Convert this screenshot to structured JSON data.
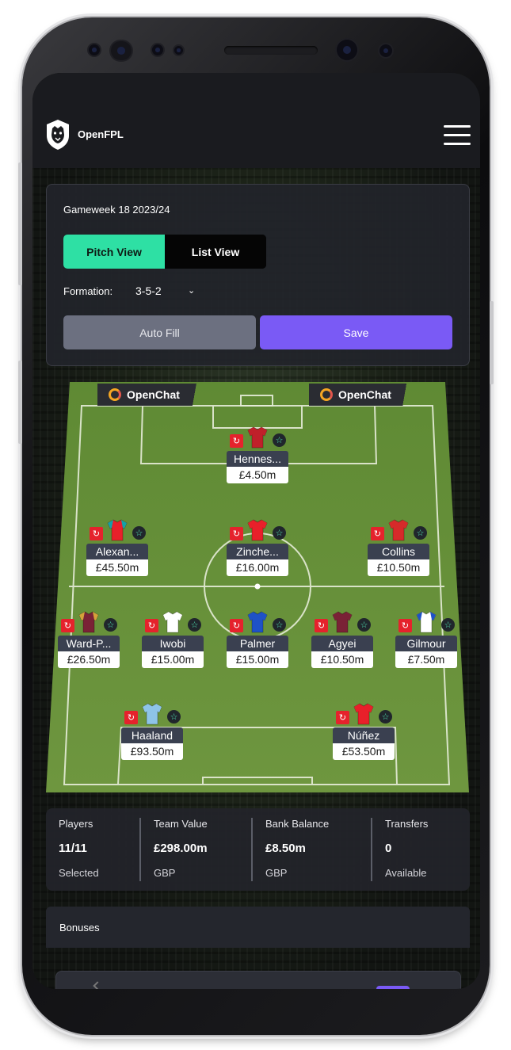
{
  "app": {
    "name": "OpenFPL"
  },
  "header": {
    "menu_icon": "hamburger-menu-icon",
    "logo_icon": "panther-shield-logo"
  },
  "team_panel": {
    "gameweek_label": "Gameweek 18 2023/24",
    "view_toggle": {
      "pitch_view": "Pitch View",
      "list_view": "List View",
      "selected": "Pitch View"
    },
    "formation_label": "Formation:",
    "formation_value": "3-5-2",
    "auto_fill_label": "Auto Fill",
    "save_label": "Save"
  },
  "sponsors": {
    "left": "OpenChat",
    "right": "OpenChat"
  },
  "players": [
    {
      "name": "Hennes...",
      "price": "£4.50m",
      "kit": "#c0202a",
      "sleeve": "#c0202a",
      "position": "GK"
    },
    {
      "name": "Alexan...",
      "price": "£45.50m",
      "kit": "#e8202a",
      "sleeve": "#12a2a8",
      "position": "DEF"
    },
    {
      "name": "Zinche...",
      "price": "£16.00m",
      "kit": "#e8202a",
      "sleeve": "#e8202a",
      "position": "DEF"
    },
    {
      "name": "Collins",
      "price": "£10.50m",
      "kit": "#d62a2a",
      "sleeve": "#d62a2a",
      "position": "DEF"
    },
    {
      "name": "Ward-P...",
      "price": "£26.50m",
      "kit": "#7a2236",
      "sleeve": "#d4a23a",
      "position": "MID"
    },
    {
      "name": "Iwobi",
      "price": "£15.00m",
      "kit": "#ffffff",
      "sleeve": "#ffffff",
      "position": "MID"
    },
    {
      "name": "Palmer",
      "price": "£15.00m",
      "kit": "#1f52c6",
      "sleeve": "#1f52c6",
      "position": "MID"
    },
    {
      "name": "Agyei",
      "price": "£10.50m",
      "kit": "#7a2236",
      "sleeve": "#7a2236",
      "position": "MID"
    },
    {
      "name": "Gilmour",
      "price": "£7.50m",
      "kit": "#ffffff",
      "sleeve": "#1f52c6",
      "position": "MID"
    },
    {
      "name": "Haaland",
      "price": "£93.50m",
      "kit": "#8ec4e8",
      "sleeve": "#8ec4e8",
      "position": "FWD"
    },
    {
      "name": "Núñez",
      "price": "£53.50m",
      "kit": "#e8202a",
      "sleeve": "#e8202a",
      "position": "FWD"
    }
  ],
  "stats": {
    "players": {
      "label": "Players",
      "value": "11/11",
      "sub": "Selected"
    },
    "team_value": {
      "label": "Team Value",
      "value": "£298.00m",
      "sub": "GBP"
    },
    "bank_balance": {
      "label": "Bank Balance",
      "value": "£8.50m",
      "sub": "GBP"
    },
    "transfers": {
      "label": "Transfers",
      "value": "0",
      "sub": "Available"
    }
  },
  "bonuses": {
    "title": "Bonuses"
  },
  "colors": {
    "accent_green": "#2ee0a4",
    "accent_purple": "#7a5af5",
    "pitch": "#6b8f3a",
    "sub_red": "#e5222c"
  }
}
